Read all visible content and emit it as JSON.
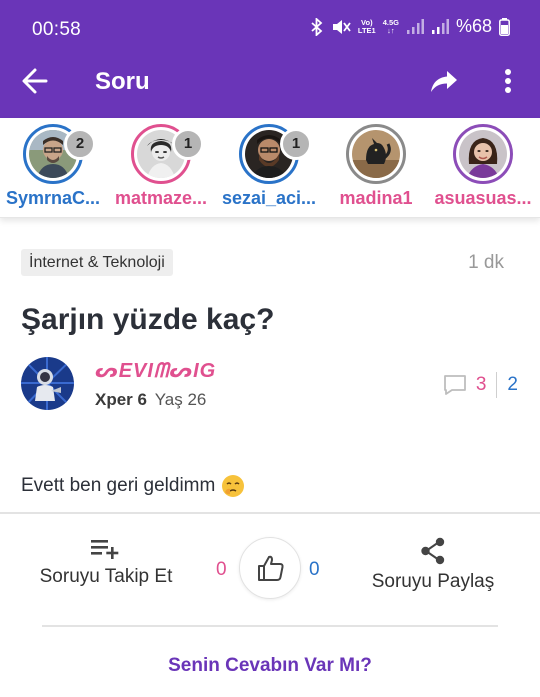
{
  "status_bar": {
    "time": "00:58",
    "network_top": "Vo)",
    "network_bottom": "LTE1",
    "network_gen": "4.5G",
    "battery": "%68"
  },
  "app_bar": {
    "title": "Soru",
    "background_color": "#6a35b8"
  },
  "stories": [
    {
      "name": "SymrnaC...",
      "badge": "2",
      "ring_color": "blue",
      "icon": "avatar-man-glasses"
    },
    {
      "name": "matmaze...",
      "badge": "1",
      "ring_color": "pink",
      "icon": "avatar-woman-vintage"
    },
    {
      "name": "sezai_aci...",
      "badge": "1",
      "ring_color": "blue",
      "icon": "avatar-man-beard"
    },
    {
      "name": "madina1",
      "badge": "",
      "ring_color": "grey",
      "icon": "avatar-cat"
    },
    {
      "name": "asuasuas...",
      "badge": "",
      "ring_color": "purple",
      "icon": "avatar-woman"
    }
  ],
  "question": {
    "category": "İnternet & Teknoloji",
    "time_ago": "1 dk",
    "title": "Şarjın yüzde kaç?",
    "author": {
      "username": "ᔕEVIᗰᔕIG",
      "xp_label": "Xper 6",
      "age_label": "Yaş 26"
    },
    "comment_count": "3",
    "answer_count": "2",
    "body": "Evett ben geri geldimm",
    "body_emoji": "shushing-face-icon"
  },
  "actions": {
    "follow_label": "Soruyu Takip Et",
    "down_votes": "0",
    "up_votes": "0",
    "share_label": "Soruyu Paylaş"
  },
  "answer_prompt": "Senin Cevabın Var Mı?",
  "colors": {
    "accent_purple": "#6a35b8",
    "pink": "#e0508f",
    "blue": "#2a73c8"
  }
}
